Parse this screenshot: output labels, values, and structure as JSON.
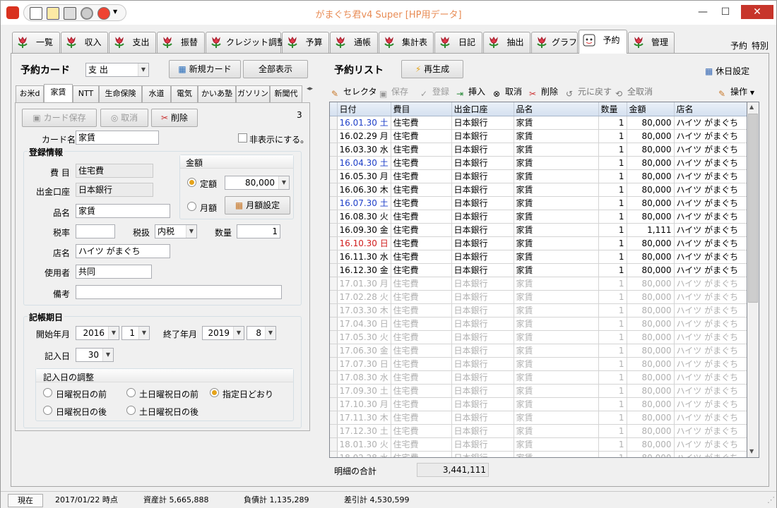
{
  "window": {
    "title": "がまぐち君v4 Super  [HP用データ]",
    "min": "—",
    "max": "☐",
    "close": "✕"
  },
  "tabs": [
    {
      "label": "一覧"
    },
    {
      "label": "収入"
    },
    {
      "label": "支出"
    },
    {
      "label": "振替"
    },
    {
      "label": "クレジット調整"
    },
    {
      "label": "予算"
    },
    {
      "label": "通帳"
    },
    {
      "label": "集計表"
    },
    {
      "label": "日記"
    },
    {
      "label": "抽出"
    },
    {
      "label": "グラフ"
    },
    {
      "label": "予約"
    },
    {
      "label": "管理"
    }
  ],
  "corner": {
    "text1": "予約",
    "text2": "特別"
  },
  "left": {
    "heading": "予約カード",
    "type_value": "支 出",
    "new_card": "新規カード",
    "show_all": "全部表示",
    "card_tabs": [
      "お米d",
      "家賃",
      "NTT",
      "生命保険",
      "水道",
      "電気",
      "かいあ塾",
      "ガソリン",
      "新聞代"
    ],
    "card_save": "カード保存",
    "cancel": "取消",
    "delete": "削除",
    "count": "3",
    "card_name_label": "カード名",
    "card_name": "家賃",
    "hide_label": "非表示にする。",
    "reg_label": "登録情報",
    "himoku_label": "費 目",
    "himoku": "住宅費",
    "account_label": "出金口座",
    "account": "日本銀行",
    "item_label": "品名",
    "item": "家賃",
    "tax_label": "税率",
    "tax": "",
    "taxmode_label": "税扱",
    "taxmode": "内税",
    "qty_label": "数量",
    "qty": "1",
    "shop_label": "店名",
    "shop": "ハイツ がまぐち",
    "user_label": "使用者",
    "user": "共同",
    "memo_label": "備考",
    "memo": "",
    "amount_group": "金額",
    "fixed_label": "定額",
    "fixed_value": "80,000",
    "monthly_label": "月額",
    "monthly_btn": "月額設定",
    "period_label": "記帳期日",
    "start_label": "開始年月",
    "start_year": "2016",
    "start_month": "1",
    "end_label": "終了年月",
    "end_year": "2019",
    "end_month": "8",
    "day_label": "記入日",
    "day": "30",
    "adjust_label": "記入日の調整",
    "opt1": "日曜祝日の前",
    "opt2": "土日曜祝日の前",
    "opt3": "指定日どおり",
    "opt4": "日曜祝日の後",
    "opt5": "土日曜祝日の後"
  },
  "right": {
    "heading": "予約リスト",
    "regen": "再生成",
    "holiday": "休日設定",
    "toolbar": {
      "selector": "セレクタ",
      "save": "保存",
      "register": "登録",
      "insert": "挿入",
      "cancel": "取消",
      "delete": "削除",
      "undo": "元に戻す",
      "cancel_all": "全取消",
      "ops": "操作"
    },
    "columns": [
      "日付",
      "費目",
      "出金口座",
      "品名",
      "数量",
      "金額",
      "店名"
    ],
    "rows": [
      {
        "date": "16.01.30 土",
        "himoku": "住宅費",
        "account": "日本銀行",
        "item": "家賃",
        "qty": "1",
        "amount": "80,000",
        "shop": "ハイツ がまぐち",
        "kind": "sat",
        "past": true
      },
      {
        "date": "16.02.29 月",
        "himoku": "住宅費",
        "account": "日本銀行",
        "item": "家賃",
        "qty": "1",
        "amount": "80,000",
        "shop": "ハイツ がまぐち",
        "kind": "",
        "past": true
      },
      {
        "date": "16.03.30 水",
        "himoku": "住宅費",
        "account": "日本銀行",
        "item": "家賃",
        "qty": "1",
        "amount": "80,000",
        "shop": "ハイツ がまぐち",
        "kind": "",
        "past": true
      },
      {
        "date": "16.04.30 土",
        "himoku": "住宅費",
        "account": "日本銀行",
        "item": "家賃",
        "qty": "1",
        "amount": "80,000",
        "shop": "ハイツ がまぐち",
        "kind": "sat",
        "past": true
      },
      {
        "date": "16.05.30 月",
        "himoku": "住宅費",
        "account": "日本銀行",
        "item": "家賃",
        "qty": "1",
        "amount": "80,000",
        "shop": "ハイツ がまぐち",
        "kind": "",
        "past": true
      },
      {
        "date": "16.06.30 木",
        "himoku": "住宅費",
        "account": "日本銀行",
        "item": "家賃",
        "qty": "1",
        "amount": "80,000",
        "shop": "ハイツ がまぐち",
        "kind": "",
        "past": true
      },
      {
        "date": "16.07.30 土",
        "himoku": "住宅費",
        "account": "日本銀行",
        "item": "家賃",
        "qty": "1",
        "amount": "80,000",
        "shop": "ハイツ がまぐち",
        "kind": "sat",
        "past": true
      },
      {
        "date": "16.08.30 火",
        "himoku": "住宅費",
        "account": "日本銀行",
        "item": "家賃",
        "qty": "1",
        "amount": "80,000",
        "shop": "ハイツ がまぐち",
        "kind": "",
        "past": true
      },
      {
        "date": "16.09.30 金",
        "himoku": "住宅費",
        "account": "日本銀行",
        "item": "家賃",
        "qty": "1",
        "amount": "1,111",
        "shop": "ハイツ がまぐち",
        "kind": "",
        "past": true
      },
      {
        "date": "16.10.30 日",
        "himoku": "住宅費",
        "account": "日本銀行",
        "item": "家賃",
        "qty": "1",
        "amount": "80,000",
        "shop": "ハイツ がまぐち",
        "kind": "sun",
        "past": true
      },
      {
        "date": "16.11.30 水",
        "himoku": "住宅費",
        "account": "日本銀行",
        "item": "家賃",
        "qty": "1",
        "amount": "80,000",
        "shop": "ハイツ がまぐち",
        "kind": "",
        "past": true
      },
      {
        "date": "16.12.30 金",
        "himoku": "住宅費",
        "account": "日本銀行",
        "item": "家賃",
        "qty": "1",
        "amount": "80,000",
        "shop": "ハイツ がまぐち",
        "kind": "",
        "past": true
      },
      {
        "date": "17.01.30 月",
        "himoku": "住宅費",
        "account": "日本銀行",
        "item": "家賃",
        "qty": "1",
        "amount": "80,000",
        "shop": "ハイツ がまぐち",
        "kind": "",
        "past": false
      },
      {
        "date": "17.02.28 火",
        "himoku": "住宅費",
        "account": "日本銀行",
        "item": "家賃",
        "qty": "1",
        "amount": "80,000",
        "shop": "ハイツ がまぐち",
        "kind": "",
        "past": false
      },
      {
        "date": "17.03.30 木",
        "himoku": "住宅費",
        "account": "日本銀行",
        "item": "家賃",
        "qty": "1",
        "amount": "80,000",
        "shop": "ハイツ がまぐち",
        "kind": "",
        "past": false
      },
      {
        "date": "17.04.30 日",
        "himoku": "住宅費",
        "account": "日本銀行",
        "item": "家賃",
        "qty": "1",
        "amount": "80,000",
        "shop": "ハイツ がまぐち",
        "kind": "",
        "past": false
      },
      {
        "date": "17.05.30 火",
        "himoku": "住宅費",
        "account": "日本銀行",
        "item": "家賃",
        "qty": "1",
        "amount": "80,000",
        "shop": "ハイツ がまぐち",
        "kind": "",
        "past": false
      },
      {
        "date": "17.06.30 金",
        "himoku": "住宅費",
        "account": "日本銀行",
        "item": "家賃",
        "qty": "1",
        "amount": "80,000",
        "shop": "ハイツ がまぐち",
        "kind": "",
        "past": false
      },
      {
        "date": "17.07.30 日",
        "himoku": "住宅費",
        "account": "日本銀行",
        "item": "家賃",
        "qty": "1",
        "amount": "80,000",
        "shop": "ハイツ がまぐち",
        "kind": "",
        "past": false
      },
      {
        "date": "17.08.30 水",
        "himoku": "住宅費",
        "account": "日本銀行",
        "item": "家賃",
        "qty": "1",
        "amount": "80,000",
        "shop": "ハイツ がまぐち",
        "kind": "",
        "past": false
      },
      {
        "date": "17.09.30 土",
        "himoku": "住宅費",
        "account": "日本銀行",
        "item": "家賃",
        "qty": "1",
        "amount": "80,000",
        "shop": "ハイツ がまぐち",
        "kind": "",
        "past": false
      },
      {
        "date": "17.10.30 月",
        "himoku": "住宅費",
        "account": "日本銀行",
        "item": "家賃",
        "qty": "1",
        "amount": "80,000",
        "shop": "ハイツ がまぐち",
        "kind": "",
        "past": false
      },
      {
        "date": "17.11.30 木",
        "himoku": "住宅費",
        "account": "日本銀行",
        "item": "家賃",
        "qty": "1",
        "amount": "80,000",
        "shop": "ハイツ がまぐち",
        "kind": "",
        "past": false
      },
      {
        "date": "17.12.30 土",
        "himoku": "住宅費",
        "account": "日本銀行",
        "item": "家賃",
        "qty": "1",
        "amount": "80,000",
        "shop": "ハイツ がまぐち",
        "kind": "",
        "past": false
      },
      {
        "date": "18.01.30 火",
        "himoku": "住宅費",
        "account": "日本銀行",
        "item": "家賃",
        "qty": "1",
        "amount": "80,000",
        "shop": "ハイツ がまぐち",
        "kind": "",
        "past": false
      },
      {
        "date": "18.02.28 水",
        "himoku": "住宅費",
        "account": "日本銀行",
        "item": "家賃",
        "qty": "1",
        "amount": "80,000",
        "shop": "ハイツ がまぐち",
        "kind": "",
        "past": false
      }
    ],
    "total_label": "明細の合計",
    "total": "3,441,111"
  },
  "status": {
    "now": "現在",
    "date": "2017/01/22 時点",
    "assets": "資産計 5,665,888",
    "debts": "負債計 1,135,289",
    "net": "差引計 4,530,599"
  },
  "colors": {
    "accent": "#e5a31a",
    "title": "#e88b54",
    "sat": "#1e3fc8",
    "sun": "#d01c1c",
    "future": "#b0b0b0"
  }
}
